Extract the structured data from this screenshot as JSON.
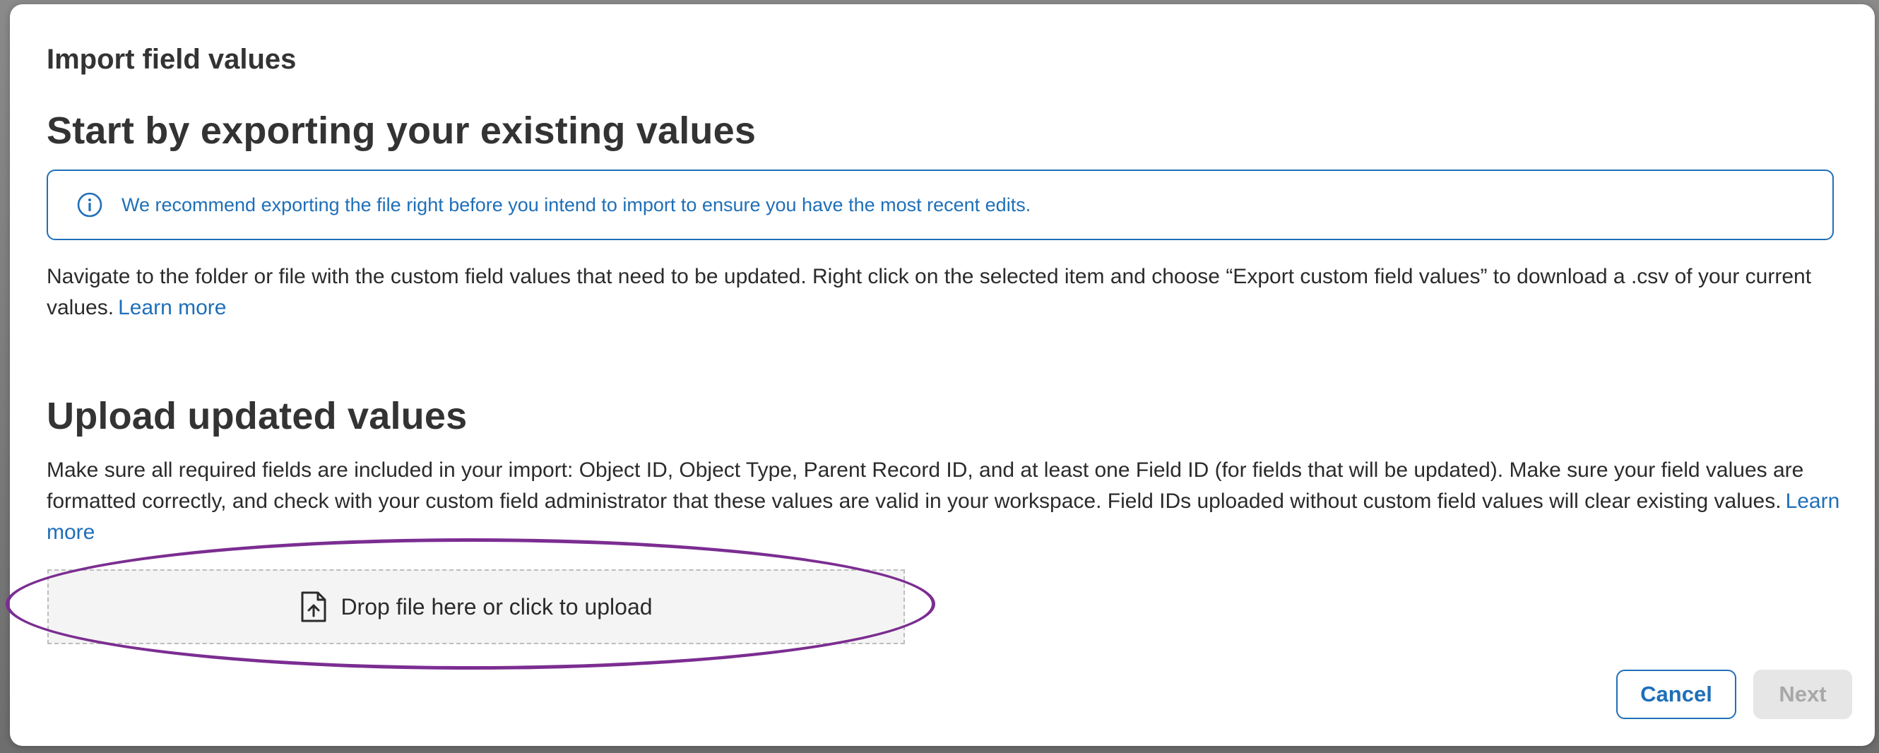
{
  "dialog": {
    "title": "Import field values"
  },
  "export_section": {
    "heading": "Start by exporting your existing values",
    "info_banner": "We recommend exporting the file right before you intend to import to ensure you have the most recent edits.",
    "description": "Navigate to the folder or file with the custom field values that need to be updated. Right click on the selected item and choose “Export custom field values” to download a .csv of your current values.",
    "learn_more": "Learn more"
  },
  "upload_section": {
    "heading": "Upload updated values",
    "description": "Make sure all required fields are included in your import: Object ID, Object Type, Parent Record ID, and at least one Field ID (for fields that will be updated). Make sure your field values are formatted correctly, and check with your custom field administrator that these values are valid in your workspace. Field IDs uploaded without custom field values will clear existing values.",
    "learn_more": "Learn more",
    "dropzone_label": "Drop file here or click to upload"
  },
  "footer": {
    "cancel_label": "Cancel",
    "next_label": "Next"
  },
  "colors": {
    "accent": "#1f6fb8",
    "highlight": "#7b2d91",
    "disabled_bg": "#e6e6e6"
  },
  "icons": {
    "info": "info-circle-icon",
    "upload": "file-upload-icon"
  }
}
